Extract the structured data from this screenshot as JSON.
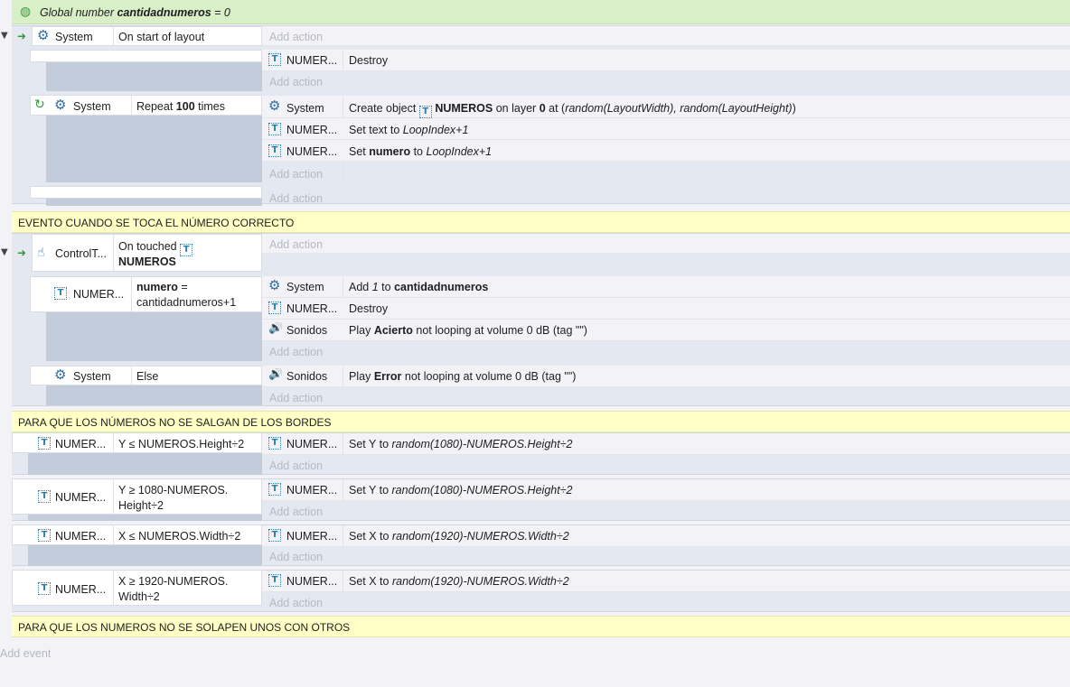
{
  "global_var": {
    "prefix": "Global number",
    "name": "cantidadnumeros",
    "suffix": "= 0"
  },
  "labels": {
    "add_action": "Add action",
    "add_event": "Add event"
  },
  "objects": {
    "system": "System",
    "numeros_trunc": "NUMER...",
    "numeros_short": "NUMER...",
    "controlt": "ControlT...",
    "sonidos": "Sonidos",
    "numeros": "NUMEROS"
  },
  "event1": {
    "condition": "On start of layout",
    "sub1_action": "Destroy",
    "sub2_condition_pre": "Repeat",
    "sub2_condition_num": "100",
    "sub2_condition_post": "times",
    "sub2_action1": {
      "pre": "Create object",
      "obj": "NUMEROS",
      "mid": "on layer",
      "layer": "0",
      "at": "at (",
      "expr": "random(LayoutWidth), random(LayoutHeight)",
      "close": ")"
    },
    "sub2_action2": {
      "pre": "Set text to",
      "expr": "LoopIndex+1"
    },
    "sub2_action3": {
      "pre": "Set",
      "var": "numero",
      "mid": "to",
      "expr": "LoopIndex+1"
    }
  },
  "comment1": "EVENTO CUANDO SE TOCA EL NÚMERO CORRECTO",
  "event2": {
    "condition_line1": "On touched",
    "condition_obj": "NUMEROS",
    "sub1_condition_var": "numero",
    "sub1_condition_eq": "=",
    "sub1_condition_line2": "cantidadnumeros+1",
    "sub1_action1": {
      "pre": "Add",
      "num": "1",
      "mid": "to",
      "var": "cantidadnumeros"
    },
    "sub1_action2": "Destroy",
    "sub1_action3": {
      "pre": "Play",
      "name": "Acierto",
      "post": "not looping at volume 0 dB (tag \"\")"
    },
    "sub2_condition": "Else",
    "sub2_action1": {
      "pre": "Play",
      "name": "Error",
      "post": "not looping at volume 0 dB (tag \"\")"
    }
  },
  "comment2": "PARA QUE LOS NÚMEROS NO SE SALGAN DE LOS BORDES",
  "bounds": [
    {
      "cond1": "Y ≤ NUMEROS.Height÷2",
      "cond2": "",
      "action_pre": "Set Y to",
      "action_expr": "random(1080)-NUMEROS.Height÷2"
    },
    {
      "cond1": "Y ≥ 1080-NUMEROS.",
      "cond2": "Height÷2",
      "action_pre": "Set Y to",
      "action_expr": "random(1080)-NUMEROS.Height÷2"
    },
    {
      "cond1": "X ≤ NUMEROS.Width÷2",
      "cond2": "",
      "action_pre": "Set X to",
      "action_expr": "random(1920)-NUMEROS.Width÷2"
    },
    {
      "cond1": "X ≥ 1920-NUMEROS.",
      "cond2": "Width÷2",
      "action_pre": "Set X to",
      "action_expr": "random(1920)-NUMEROS.Width÷2"
    }
  ],
  "comment3": "PARA QUE LOS NUMEROS NO SE SOLAPEN UNOS CON OTROS",
  "colors": {
    "comment_bg": "#ffffc6",
    "global_bg": "#d9efc8",
    "event_bg": "#e4e9f1",
    "bar": "#c2ccdb",
    "icon_blue": "#2d6ca2",
    "trigger_green": "#2e9a3a"
  }
}
